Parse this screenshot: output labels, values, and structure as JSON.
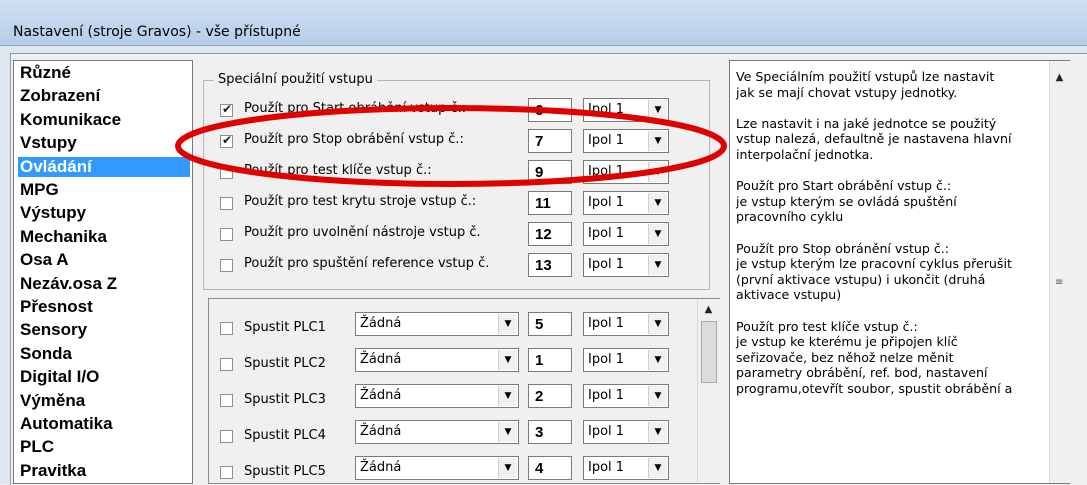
{
  "window": {
    "title": "Nastavení (stroje Gravos) - vše přístupné"
  },
  "categories": [
    "Různé",
    "Zobrazení",
    "Komunikace",
    "Vstupy",
    "Ovládání",
    "MPG",
    "Výstupy",
    "Mechanika",
    "Osa A",
    "Nezáv.osa Z",
    "Přesnost",
    "Sensory",
    "Sonda",
    "Digital I/O",
    "Výměna",
    "Automatika",
    "PLC",
    "Pravitka"
  ],
  "selected_category": "Ovládání",
  "group": {
    "title": "Speciální použití vstupu",
    "rows": [
      {
        "label": "Použít pro Start obrábění vstup č.:",
        "checked": true,
        "value": "6",
        "unit": "Ipol 1"
      },
      {
        "label": "Použít pro Stop obrábění vstup č.:",
        "checked": true,
        "value": "7",
        "unit": "Ipol 1"
      },
      {
        "label": "Použít pro test klíče vstup č.:",
        "checked": false,
        "value": "9",
        "unit": "Ipol 1"
      },
      {
        "label": "Použít pro test krytu stroje vstup č.:",
        "checked": false,
        "value": "11",
        "unit": "Ipol 1"
      },
      {
        "label": "Použít pro uvolnění nástroje vstup č.",
        "checked": false,
        "value": "12",
        "unit": "Ipol 1"
      },
      {
        "label": "Použít pro spuštění reference vstup č.",
        "checked": false,
        "value": "13",
        "unit": "Ipol 1"
      }
    ]
  },
  "plc": {
    "rows": [
      {
        "label": "Spustit PLC1",
        "program": "Žádná",
        "value": "5",
        "unit": "Ipol 1"
      },
      {
        "label": "Spustit PLC2",
        "program": "Žádná",
        "value": "1",
        "unit": "Ipol 1"
      },
      {
        "label": "Spustit PLC3",
        "program": "Žádná",
        "value": "2",
        "unit": "Ipol 1"
      },
      {
        "label": "Spustit PLC4",
        "program": "Žádná",
        "value": "3",
        "unit": "Ipol 1"
      },
      {
        "label": "Spustit PLC5",
        "program": "Žádná",
        "value": "4",
        "unit": "Ipol 1"
      }
    ]
  },
  "help_lines": [
    "Ve Speciálním použití vstupů lze nastavit",
    "jak se mají chovat vstupy jednotky.",
    "",
    "Lze nastavit i na jaké jednotce se použitý",
    "vstup nalezá, defaultně je nastavena hlavní",
    "interpolační jednotka.",
    "",
    "Použít pro Start obrábění vstup č.:",
    "je vstup kterým se ovládá spuštění",
    "pracovního cyklu",
    "",
    "Použít pro Stop obránění vstup č.:",
    "je vstup kterým lze pracovní cyklus přerušit",
    "(první aktivace vstupu) i ukončit (druhá",
    "aktivace vstupu)",
    "",
    "Použít pro test klíče vstup č.:",
    "je vstup ke kterému je připojen klíč",
    "seřizovače, bez něhož nelze měnit",
    "parametry obrábění, ref. bod, nastavení",
    "programu,otevřít soubor, spustit obrábění a"
  ],
  "colors": {
    "selection": "#3399ff",
    "annotation": "#e00000"
  }
}
